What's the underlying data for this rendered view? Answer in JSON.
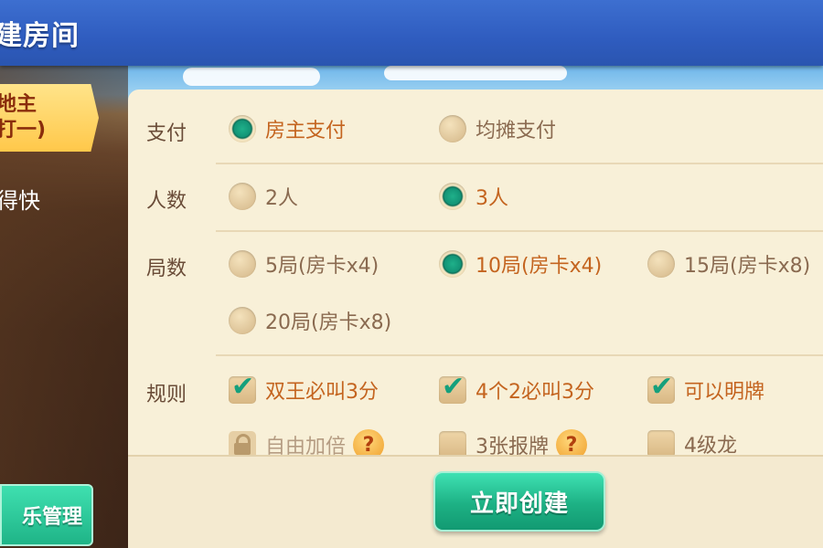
{
  "header": {
    "title": "建房间"
  },
  "sidebar": {
    "active_tab_line1": "地主",
    "active_tab_line2": "打一)",
    "tab2": "得快",
    "manage_button": "乐管理"
  },
  "rows": {
    "pay": {
      "label": "支付",
      "options": [
        {
          "text": "房主支付",
          "selected": true
        },
        {
          "text": "均摊支付",
          "selected": false
        }
      ]
    },
    "players": {
      "label": "人数",
      "options": [
        {
          "text": "2人",
          "selected": false
        },
        {
          "text": "3人",
          "selected": true
        }
      ]
    },
    "rounds": {
      "label": "局数",
      "options": [
        {
          "text": "5局(房卡x4)",
          "selected": false
        },
        {
          "text": "10局(房卡x4)",
          "selected": true
        },
        {
          "text": "15局(房卡x8)",
          "selected": false
        },
        {
          "text": "20局(房卡x8)",
          "selected": false
        }
      ]
    },
    "rules": {
      "label": "规则",
      "options": [
        {
          "text": "双王必叫3分",
          "checked": true
        },
        {
          "text": "4个2必叫3分",
          "checked": true
        },
        {
          "text": "可以明牌",
          "checked": true
        },
        {
          "text": "自由加倍",
          "checked": false,
          "locked": true
        },
        {
          "text": "3张报牌",
          "checked": false
        },
        {
          "text": "4级龙",
          "checked": false
        }
      ]
    }
  },
  "help_icon_text": "?",
  "create_button": "立即创建",
  "colors": {
    "accent": "#1db184",
    "selected_text": "#c4641f",
    "panel": "#f8f0d8"
  }
}
